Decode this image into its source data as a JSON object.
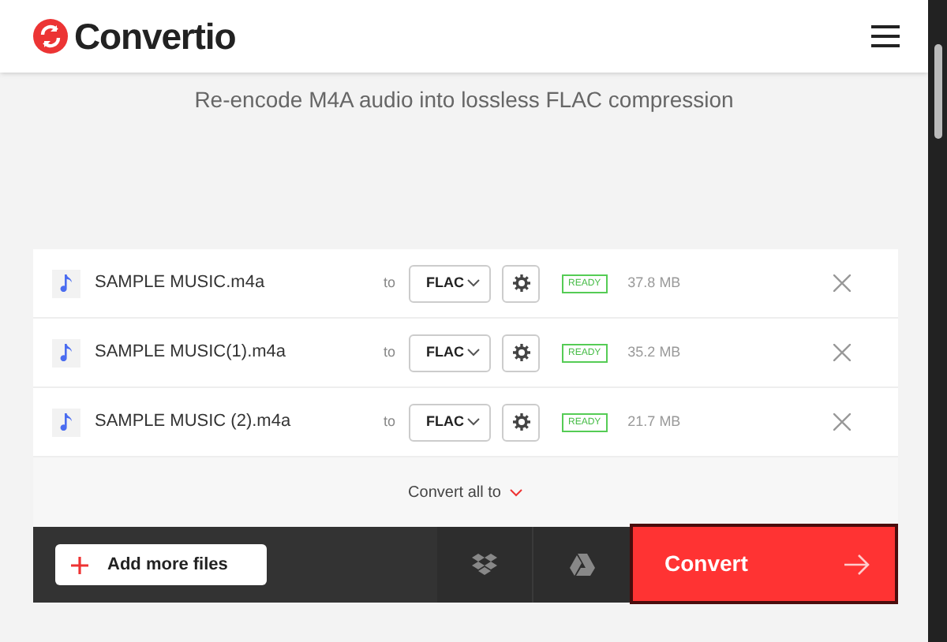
{
  "header": {
    "logo_text": "Convertio"
  },
  "subtitle": "Re-encode M4A audio into lossless FLAC compression",
  "files": [
    {
      "name": "SAMPLE MUSIC.m4a",
      "to": "to",
      "format": "FLAC",
      "status": "READY",
      "size": "37.8 MB"
    },
    {
      "name": "SAMPLE MUSIC(1).m4a",
      "to": "to",
      "format": "FLAC",
      "status": "READY",
      "size": "35.2 MB"
    },
    {
      "name": "SAMPLE MUSIC (2).m4a",
      "to": "to",
      "format": "FLAC",
      "status": "READY",
      "size": "21.7 MB"
    }
  ],
  "convert_all": "Convert all to",
  "add_button": "Add more files",
  "convert_button": "Convert"
}
